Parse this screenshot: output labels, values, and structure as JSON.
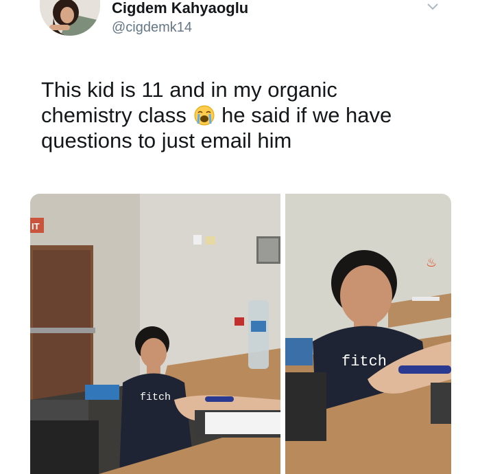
{
  "author": {
    "name": "Cigdem Kahyaoglu",
    "handle": "@cigdemk14",
    "avatar_icon": "profile-photo"
  },
  "tweet": {
    "lines": [
      "This kid is 11 and in my organic",
      "chemistry class",
      "he said if we have",
      "questions to just email him"
    ],
    "emoji": "loudly-crying-face"
  },
  "menu_icon": "chevron-down-icon",
  "media": {
    "photos": [
      {
        "shirt_text": "fitch",
        "exit_sign": "IT"
      },
      {
        "shirt_text": "fitch"
      }
    ]
  },
  "colors": {
    "name": "#14171a",
    "handle": "#657786",
    "shirt": "#1e2433",
    "desk": "#b98a5c",
    "wall": "#d8d6ce"
  }
}
